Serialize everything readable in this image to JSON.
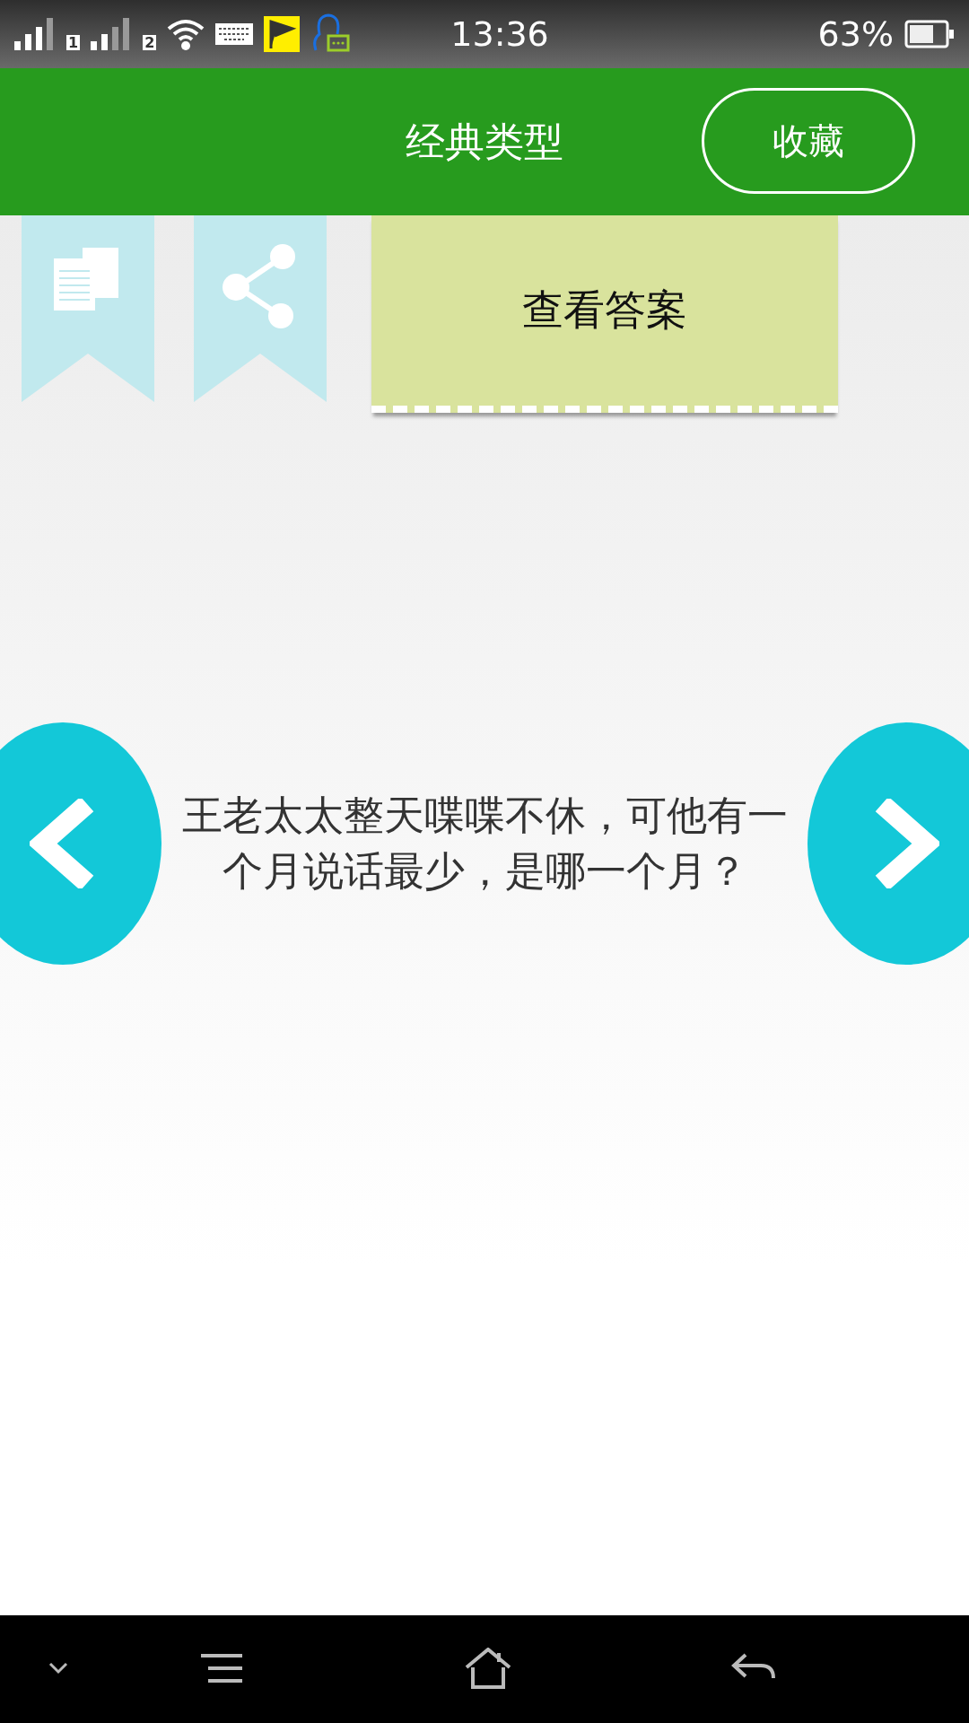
{
  "status_bar": {
    "sim_slots": [
      "1",
      "2"
    ],
    "time": "13:36",
    "battery": "63%"
  },
  "header": {
    "title": "经典类型",
    "favorite_button": "收藏"
  },
  "answer_button": "查看答案",
  "question": "王老太太整天喋喋不休，可他有一个月说话最少，是哪一个月？"
}
